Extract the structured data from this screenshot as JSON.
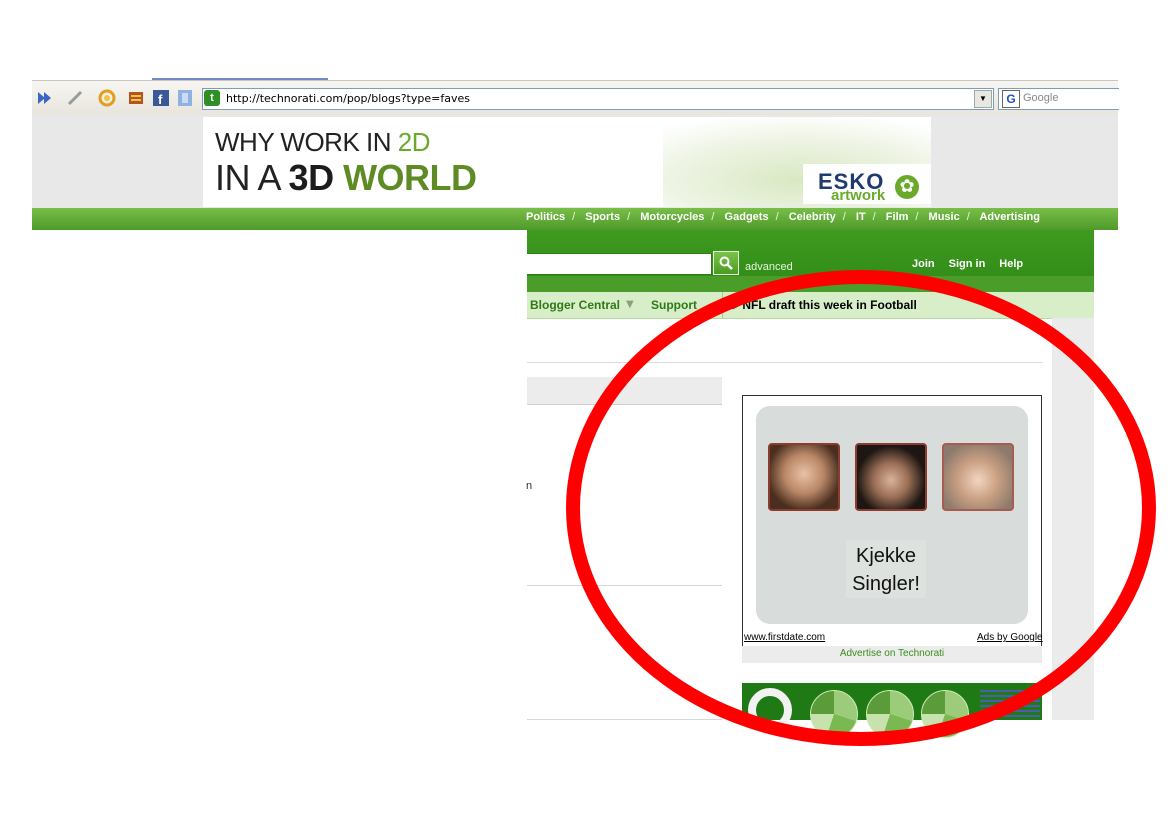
{
  "browser": {
    "url": "http://technorati.com/pop/blogs?type=faves",
    "search_placeholder": "Google",
    "search_logo": "G",
    "site_icon": "technorati-favicon"
  },
  "banner": {
    "line1_a": "WHY WORK IN ",
    "line1_b": "2D",
    "line2_a": "IN A ",
    "line2_b": "3D ",
    "line2_c": "WORLD",
    "brand": "ESKO",
    "brand_sub": "artwork"
  },
  "catnav": {
    "items": [
      "Politics",
      "Sports",
      "Motorcycles",
      "Gadgets",
      "Celebrity",
      "IT",
      "Film",
      "Music",
      "Advertising"
    ]
  },
  "header": {
    "advanced": "advanced",
    "links": [
      "Join",
      "Sign in",
      "Help"
    ]
  },
  "subnav": {
    "blogger_central": "Blogger Central",
    "support": "Support",
    "news": "▸ NFL draft this week in Football"
  },
  "content": {
    "truncated_text": "n"
  },
  "ad": {
    "caption": "Kjekke Singler!",
    "url": "www.firstdate.com",
    "ads_by": "Ads by Google",
    "advertise": "Advertise on Technorati"
  },
  "colors": {
    "brand_green": "#3f9a1f",
    "annotation_red": "#ff0000"
  }
}
